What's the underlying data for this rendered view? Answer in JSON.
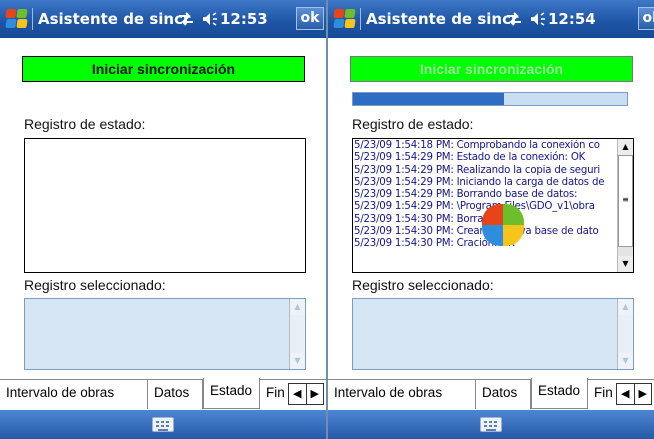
{
  "screens": [
    {
      "title": "Asistente de sincr",
      "clock": "12:53",
      "ok_label": "ok",
      "sync_button": "Iniciar sincronización",
      "state_label": "Registro de estado:",
      "selected_label": "Registro seleccionado:",
      "tabs": [
        "Intervalo de obras",
        "Datos",
        "Estado",
        "Fin"
      ]
    },
    {
      "title": "Asistente de sincr",
      "clock": "12:54",
      "ok_label": "ok",
      "sync_button": "Iniciar sincronización",
      "progress": 0.55,
      "state_label": "Registro de estado:",
      "selected_label": "Registro seleccionado:",
      "log": [
        "5/23/09 1:54:18 PM: Comprobando la conexión co",
        "5/23/09 1:54:29 PM: Estado de la conexión: OK",
        "5/23/09 1:54:29 PM: Realizando la copia de seguri",
        "5/23/09 1:54:29 PM: Iniciando la carga de datos de",
        "5/23/09 1:54:29 PM: Borrando base de datos:",
        "5/23/09 1:54:29 PM: \\Program Files\\GDO_v1\\obra",
        "5/23/09 1:54:30 PM: Borrado: OK",
        "5/23/09 1:54:30 PM: Creando nueva base de dato",
        "5/23/09 1:54:30 PM: Cración: OK"
      ],
      "tabs": [
        "Intervalo de obras",
        "Datos",
        "Estado",
        "Fin"
      ]
    }
  ],
  "icons": {
    "start": "windows-start-icon",
    "connectivity": "connectivity-icon",
    "volume": "volume-icon",
    "busy": "busy-wait-icon",
    "keyboard": "keyboard-icon"
  },
  "colors": {
    "titlebar": "#1f56a6",
    "sync_button": "#00ff00",
    "progress_fill": "#2d6dc4",
    "log_text": "#14148a"
  }
}
